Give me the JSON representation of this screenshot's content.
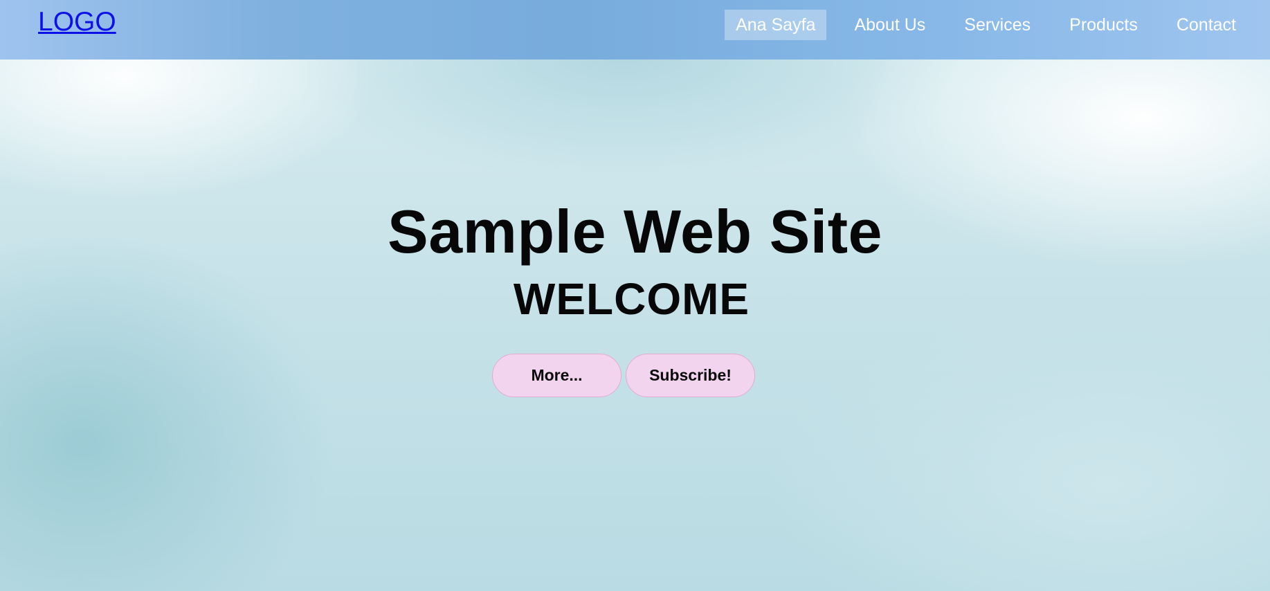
{
  "header": {
    "logo": "LOGO",
    "nav": [
      {
        "label": "Ana Sayfa",
        "active": true
      },
      {
        "label": "About Us",
        "active": false
      },
      {
        "label": "Services",
        "active": false
      },
      {
        "label": "Products",
        "active": false
      },
      {
        "label": "Contact",
        "active": false
      }
    ]
  },
  "hero": {
    "title": "Sample Web Site",
    "subtitle": "WELCOME",
    "buttons": {
      "more": "More...",
      "subscribe": "Subscribe!"
    }
  },
  "colors": {
    "navbar": "#82b3e2",
    "logo": "#0d11e8",
    "button_fill": "#f2d4ef",
    "button_border": "#e3abd2",
    "text": "#070707"
  }
}
